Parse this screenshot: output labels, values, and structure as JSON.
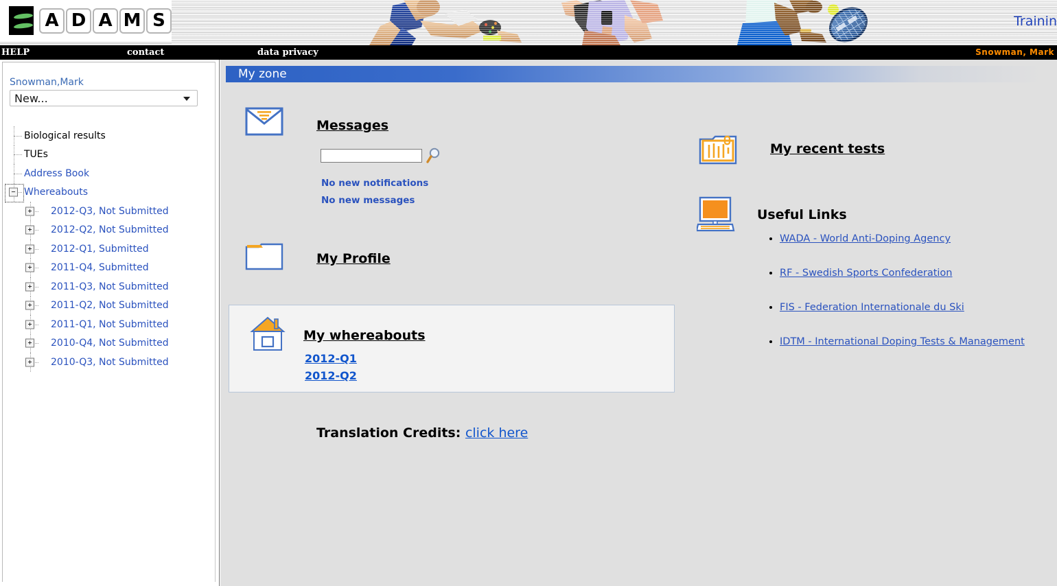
{
  "banner": {
    "logo_letters": [
      "A",
      "D",
      "A",
      "M",
      "S"
    ],
    "training_label": "Trainin"
  },
  "topnav": {
    "help": "HELP",
    "contact": "contact",
    "data_privacy": "data privacy",
    "user": "Snowman, Mark"
  },
  "sidebar": {
    "user_name": "Snowman,Mark",
    "new_select_value": "New...",
    "tree": [
      {
        "label": "Biological results",
        "link": false,
        "level": 1,
        "expander": null
      },
      {
        "label": "TUEs",
        "link": false,
        "level": 1,
        "expander": null
      },
      {
        "label": "Address Book",
        "link": true,
        "level": 1,
        "expander": null
      },
      {
        "label": "Whereabouts",
        "link": true,
        "level": 1,
        "expander": "−",
        "focused": true
      },
      {
        "label": "2012-Q3, Not Submitted",
        "link": true,
        "level": 2,
        "expander": "+"
      },
      {
        "label": "2012-Q2, Not Submitted",
        "link": true,
        "level": 2,
        "expander": "+"
      },
      {
        "label": "2012-Q1, Submitted",
        "link": true,
        "level": 2,
        "expander": "+"
      },
      {
        "label": "2011-Q4, Submitted",
        "link": true,
        "level": 2,
        "expander": "+"
      },
      {
        "label": "2011-Q3, Not Submitted",
        "link": true,
        "level": 2,
        "expander": "+"
      },
      {
        "label": "2011-Q2, Not Submitted",
        "link": true,
        "level": 2,
        "expander": "+"
      },
      {
        "label": "2011-Q1, Not Submitted",
        "link": true,
        "level": 2,
        "expander": "+"
      },
      {
        "label": "2010-Q4, Not Submitted",
        "link": true,
        "level": 2,
        "expander": "+"
      },
      {
        "label": "2010-Q3, Not Submitted",
        "link": true,
        "level": 2,
        "expander": "+"
      }
    ]
  },
  "main": {
    "zone_title": "My zone",
    "messages": {
      "heading": "Messages",
      "search_value": "",
      "search_placeholder": "",
      "no_notifications": "No new notifications",
      "no_messages": "No new messages"
    },
    "profile": {
      "heading": "My Profile"
    },
    "whereabouts": {
      "heading": "My whereabouts",
      "quarters": [
        "2012-Q1",
        "2012-Q2"
      ]
    },
    "translation_credits": {
      "label": "Translation Credits:",
      "link": "click here"
    },
    "recent_tests": {
      "heading": "My recent tests"
    },
    "useful_links": {
      "heading": "Useful Links",
      "items": [
        "WADA - World Anti-Doping Agency",
        "RF - Swedish Sports Confederation",
        "FIS - Federation Internationale du Ski",
        "IDTM - International Doping Tests & Management"
      ]
    }
  },
  "colors": {
    "title_blue": "#2d62c4",
    "link_blue": "#2a52be",
    "accent_orange": "#ff9900",
    "nav_black": "#000000",
    "panel_gray": "#e0e0e0"
  }
}
